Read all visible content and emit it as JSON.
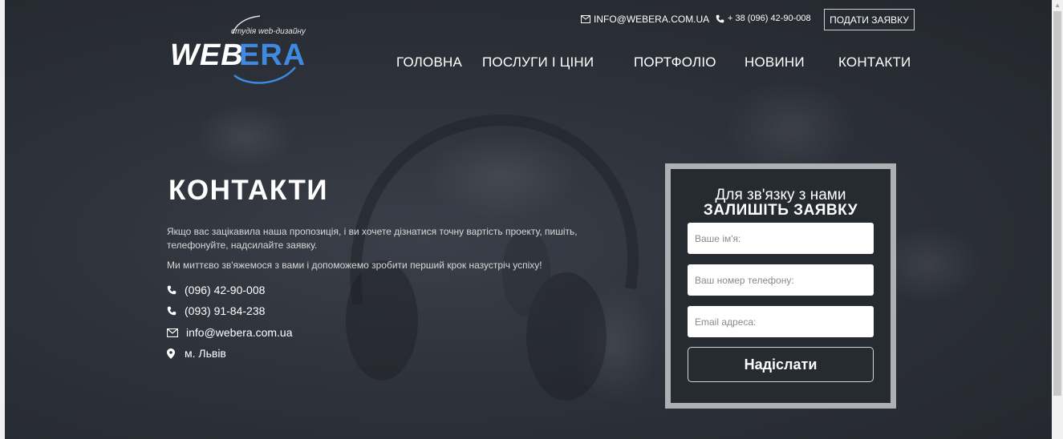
{
  "logo": {
    "tagline": "студія web-дизайну",
    "word1": "WEB",
    "word2": "ERA"
  },
  "topbar": {
    "email": "INFO@WEBERA.COM.UA",
    "phone": "+ 38 (096) 42-90-008",
    "apply_button": "ПОДАТИ ЗАЯВКУ"
  },
  "nav": [
    "ГОЛОВНА",
    "ПОСЛУГИ І ЦІНИ",
    "ПОРТФОЛІО",
    "НОВИНИ",
    "КОНТАКТИ"
  ],
  "contacts": {
    "title": "КОНТАКТИ",
    "paragraph1": "Якщо вас зацікавила наша пропозиція, і ви хочете дізнатися точну вартість проекту, пишіть, телефонуйте, надсилайте заявку.",
    "paragraph2": "Ми миттєво зв'яжемося з вами і допоможемо зробити перший крок назустріч успіху!",
    "phone1": "(096) 42-90-008",
    "phone2": "(093) 91-84-238",
    "email": "info@webera.com.ua",
    "city": "м. Львів"
  },
  "form": {
    "subtitle": "Для зв'язку з нами",
    "title": "ЗАЛИШІТЬ ЗАЯВКУ",
    "name_placeholder": "Ваше ім'я:",
    "phone_placeholder": "Ваш номер телефону:",
    "email_placeholder": "Email адреса:",
    "submit_label": "Надіслати"
  },
  "icons": {
    "top_email": "envelope-icon",
    "top_phone": "phone-icon",
    "phone": "phone-icon",
    "email": "envelope-icon",
    "location": "map-marker-icon"
  },
  "colors": {
    "accent": "#3f8ae0",
    "background": "#2d3139",
    "form_border": "#aeb0b3"
  }
}
